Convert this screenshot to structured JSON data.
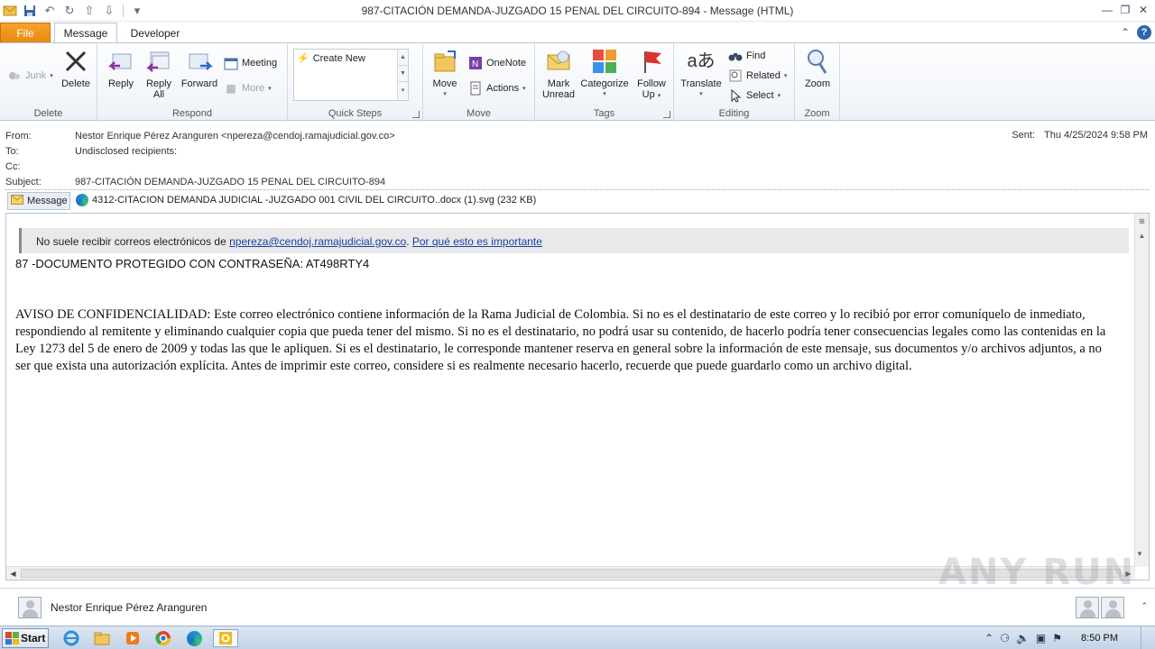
{
  "window": {
    "title": "987-CITACIÓN  DEMANDA-JUZGADO 15 PENAL DEL CIRCUITO-894 - Message (HTML)"
  },
  "tabs": {
    "file": "File",
    "message": "Message",
    "developer": "Developer"
  },
  "ribbon": {
    "delete_group": {
      "label": "Delete",
      "junk": "Junk",
      "delete": "Delete"
    },
    "respond_group": {
      "label": "Respond",
      "reply": "Reply",
      "reply_all_1": "Reply",
      "reply_all_2": "All",
      "forward": "Forward",
      "meeting": "Meeting",
      "more": "More"
    },
    "quicksteps_group": {
      "label": "Quick Steps",
      "create_new": "Create New"
    },
    "move_group": {
      "label": "Move",
      "move": "Move",
      "onenote": "OneNote",
      "actions": "Actions"
    },
    "tags_group": {
      "label": "Tags",
      "mark_unread_1": "Mark",
      "mark_unread_2": "Unread",
      "categorize": "Categorize",
      "follow_up_1": "Follow",
      "follow_up_2": "Up"
    },
    "editing_group": {
      "label": "Editing",
      "translate": "Translate",
      "find": "Find",
      "related": "Related",
      "select": "Select"
    },
    "zoom_group": {
      "label": "Zoom",
      "zoom": "Zoom"
    }
  },
  "header": {
    "from_label": "From:",
    "from_value": "Nestor Enrique Pérez Aranguren <npereza@cendoj.ramajudicial.gov.co>",
    "to_label": "To:",
    "to_value": "Undisclosed recipients:",
    "cc_label": "Cc:",
    "cc_value": "",
    "subject_label": "Subject:",
    "subject_value": "987-CITACIÓN  DEMANDA-JUZGADO 15 PENAL DEL CIRCUITO-894",
    "sent_label": "Sent:",
    "sent_value": "Thu 4/25/2024 9:58 PM"
  },
  "attachments": {
    "message_tab": "Message",
    "file": "4312-CITACION  DEMANDA JUDICIAL -JUZGADO 001 CIVIL DEL CIRCUITO..docx (1).svg (232 KB)"
  },
  "body": {
    "banner_text": "No suele recibir correos electrónicos de ",
    "banner_email": "npereza@cendoj.ramajudicial.gov.co",
    "banner_sep": ". ",
    "banner_link": "Por qué esto es importante",
    "password_line": "87 -DOCUMENTO PROTEGIDO CON CONTRASEÑA:  AT498RTY4",
    "notice": "AVISO DE CONFIDENCIALIDAD: Este correo electrónico contiene información de la Rama Judicial de Colombia. Si no es el destinatario de este correo y lo recibió por error comuníquelo de inmediato, respondiendo al remitente y eliminando cualquier copia que pueda tener del mismo. Si no es el destinatario, no podrá usar su contenido, de hacerlo podría tener consecuencias legales como las contenidas en la Ley 1273 del 5 de enero de 2009 y todas las que le apliquen. Si es el destinatario, le corresponde mantener reserva en general sobre la información de este mensaje, sus documentos y/o archivos adjuntos, a no ser que exista una autorización explícita. Antes de imprimir este correo, considere si es realmente necesario hacerlo, recuerde que puede guardarlo como un archivo digital."
  },
  "people_pane": {
    "name": "Nestor Enrique Pérez Aranguren"
  },
  "taskbar": {
    "start": "Start",
    "clock": "8:50 PM"
  },
  "watermark": "ANY RUN"
}
